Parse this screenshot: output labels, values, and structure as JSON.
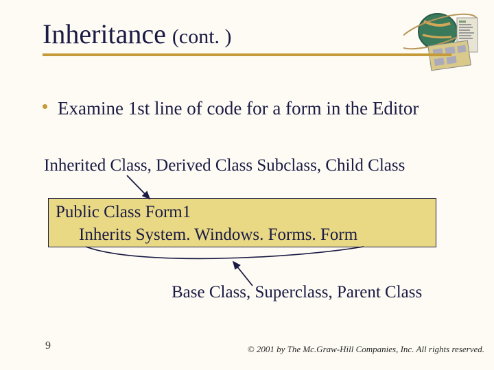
{
  "title": {
    "main": "Inheritance",
    "cont": "(cont. )"
  },
  "bullet": "Examine 1st line of code for a form in the Editor",
  "label_top": "Inherited Class, Derived Class Subclass, Child Class",
  "code": {
    "line1": "Public Class Form1",
    "line2": "Inherits System. Windows. Forms. Form"
  },
  "label_bottom": "Base Class, Superclass, Parent Class",
  "page_number": "9",
  "copyright": "© 2001 by The Mc.Graw-Hill Companies, Inc. All rights reserved."
}
